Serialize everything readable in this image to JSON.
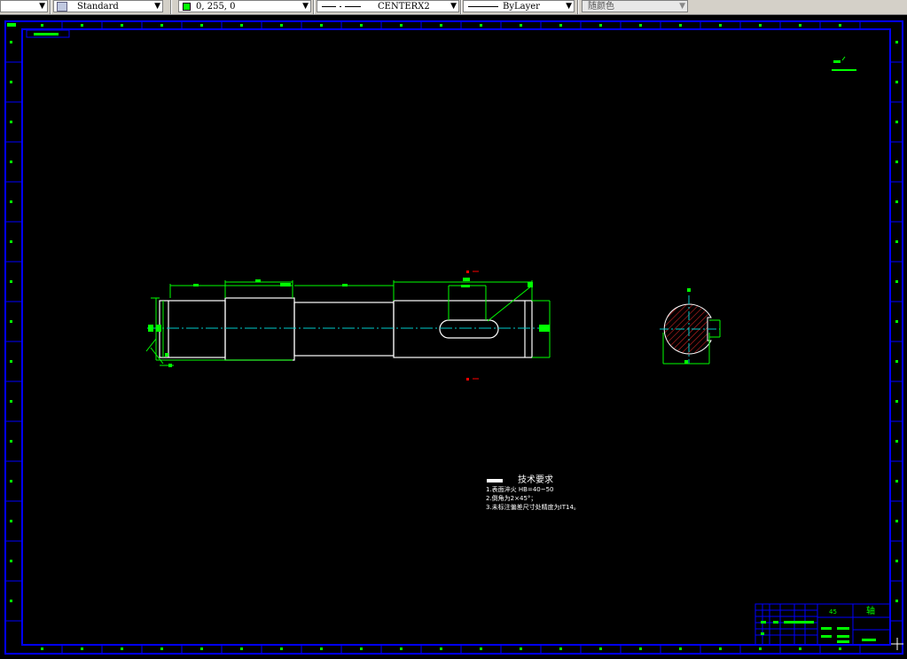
{
  "toolbar": {
    "text_style": "Standard",
    "color": "0, 255, 0",
    "color_hex": "#00ff00",
    "linetype": "CENTERX2",
    "lineweight": "ByLayer",
    "plot_style": "随颜色"
  },
  "drawing": {
    "tech_title": "技术要求",
    "tech_notes": [
      "1.表面淬火 HB=40~50",
      "2.倒角为2×45°；",
      "3.未标注偏差尺寸处精度为IT14。"
    ],
    "title_block_name": "轴",
    "title_block_material": "45"
  },
  "colors": {
    "background": "#000000",
    "frame": "#0000ff",
    "dimension": "#00ff00",
    "outline": "#ffffff",
    "centerline": "#00cccc",
    "hatch": "#cc2222",
    "section_mark": "#ff0000"
  }
}
